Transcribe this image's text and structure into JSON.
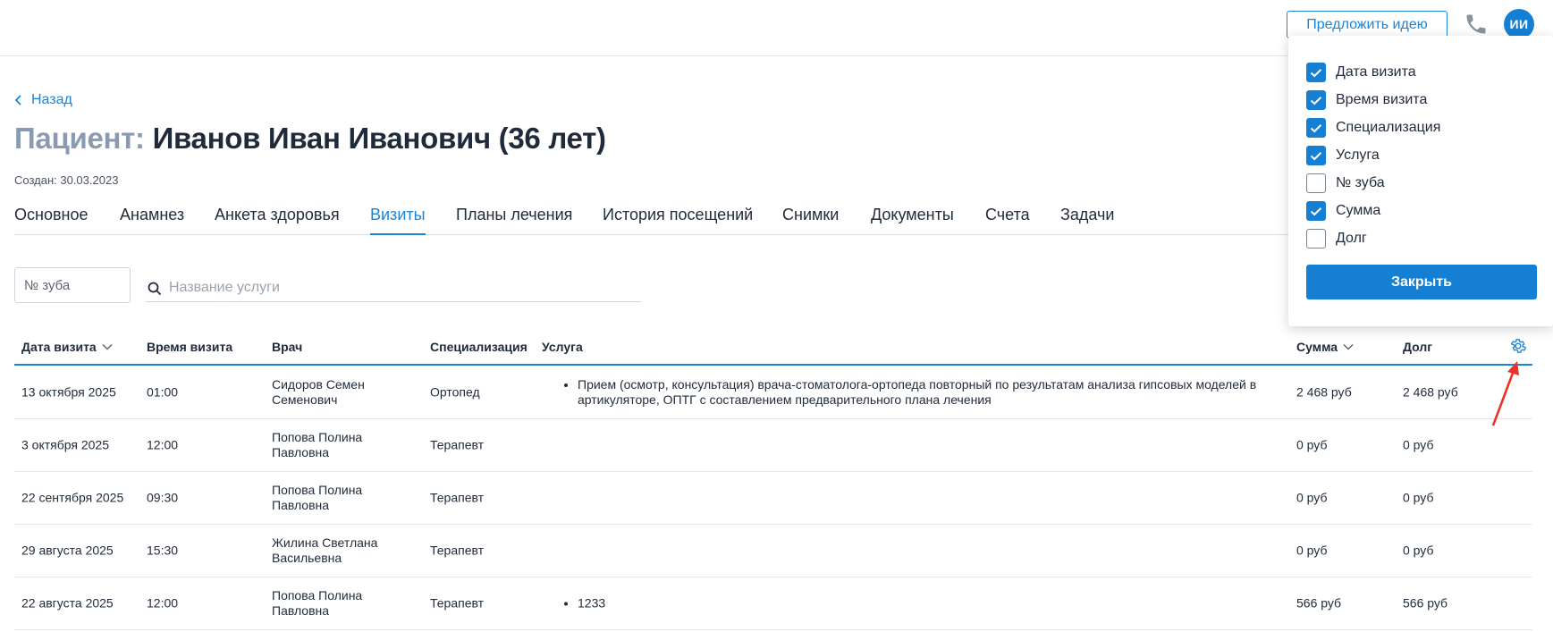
{
  "header": {
    "idea_button": "Предложить идею",
    "avatar_initials": "ИИ",
    "accent_color": "#1a85d8"
  },
  "back_link": "Назад",
  "patient": {
    "label": "Пациент:",
    "name": "Иванов Иван Иванович (36 лет)",
    "created": "Создан: 30.03.2023"
  },
  "tabs": [
    {
      "label": "Основное",
      "active": false
    },
    {
      "label": "Анамнез",
      "active": false
    },
    {
      "label": "Анкета здоровья",
      "active": false
    },
    {
      "label": "Визиты",
      "active": true
    },
    {
      "label": "Планы лечения",
      "active": false
    },
    {
      "label": "История посещений",
      "active": false
    },
    {
      "label": "Снимки",
      "active": false
    },
    {
      "label": "Документы",
      "active": false
    },
    {
      "label": "Счета",
      "active": false
    },
    {
      "label": "Задачи",
      "active": false
    }
  ],
  "filters": {
    "tooth_placeholder": "№ зуба",
    "search_placeholder": "Название услуги"
  },
  "table": {
    "columns": [
      "Дата визита",
      "Время визита",
      "Врач",
      "Специализация",
      "Услуга",
      "Сумма",
      "Долг"
    ],
    "rows": [
      {
        "date": "13 октября 2025",
        "time": "01:00",
        "doctor": [
          "Сидоров Семен",
          "Семенович"
        ],
        "spec": "Ортопед",
        "service": "Прием (осмотр, консультация) врача-стоматолога-ортопеда повторный по результатам анализа гипсовых моделей в артикуляторе, ОПТГ с составлением предварительного плана лечения",
        "sum": "2 468 руб",
        "debt": "2 468 руб"
      },
      {
        "date": "3 октября 2025",
        "time": "12:00",
        "doctor": [
          "Попова Полина",
          "Павловна"
        ],
        "spec": "Терапевт",
        "service": "",
        "sum": "0 руб",
        "debt": "0 руб"
      },
      {
        "date": "22 сентября 2025",
        "time": "09:30",
        "doctor": [
          "Попова Полина",
          "Павловна"
        ],
        "spec": "Терапевт",
        "service": "",
        "sum": "0 руб",
        "debt": "0 руб"
      },
      {
        "date": "29 августа 2025",
        "time": "15:30",
        "doctor": [
          "Жилина Светлана",
          "Васильевна"
        ],
        "spec": "Терапевт",
        "service": "",
        "sum": "0 руб",
        "debt": "0 руб"
      },
      {
        "date": "22 августа 2025",
        "time": "12:00",
        "doctor": [
          "Попова Полина",
          "Павловна"
        ],
        "spec": "Терапевт",
        "service": "1233",
        "sum": "566 руб",
        "debt": "566 руб"
      }
    ]
  },
  "column_settings": {
    "options": [
      {
        "label": "Дата визита",
        "checked": true
      },
      {
        "label": "Время визита",
        "checked": true
      },
      {
        "label": "Специализация",
        "checked": true
      },
      {
        "label": "Услуга",
        "checked": true
      },
      {
        "label": "№ зуба",
        "checked": false
      },
      {
        "label": "Сумма",
        "checked": true
      },
      {
        "label": "Долг",
        "checked": false
      }
    ],
    "close_button": "Закрыть"
  },
  "annotation_color": "#e8352b"
}
